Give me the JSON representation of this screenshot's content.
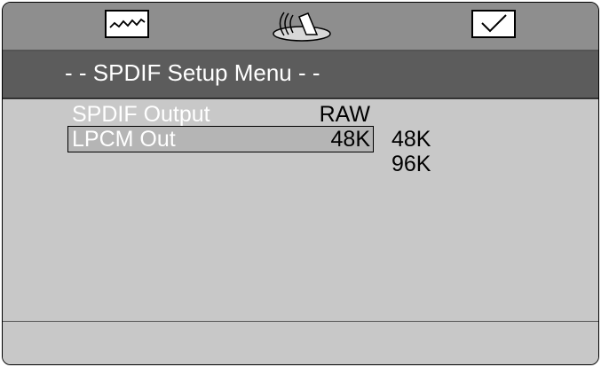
{
  "tabs": [
    {
      "icon": "waveform-icon"
    },
    {
      "icon": "speaker-icon"
    },
    {
      "icon": "checkmark-icon"
    }
  ],
  "menu": {
    "title": "- - SPDIF Setup Menu - -"
  },
  "settings": [
    {
      "label": "SPDIF Output",
      "value": "RAW"
    },
    {
      "label": "LPCM Out",
      "value": "48K"
    }
  ],
  "options": [
    "48K",
    "96K"
  ],
  "colors": {
    "top_bar": "#8e8e8e",
    "title_bar": "#5c5c5c",
    "content_bg": "#c8c8c8",
    "highlight": "#b5b5b5"
  }
}
